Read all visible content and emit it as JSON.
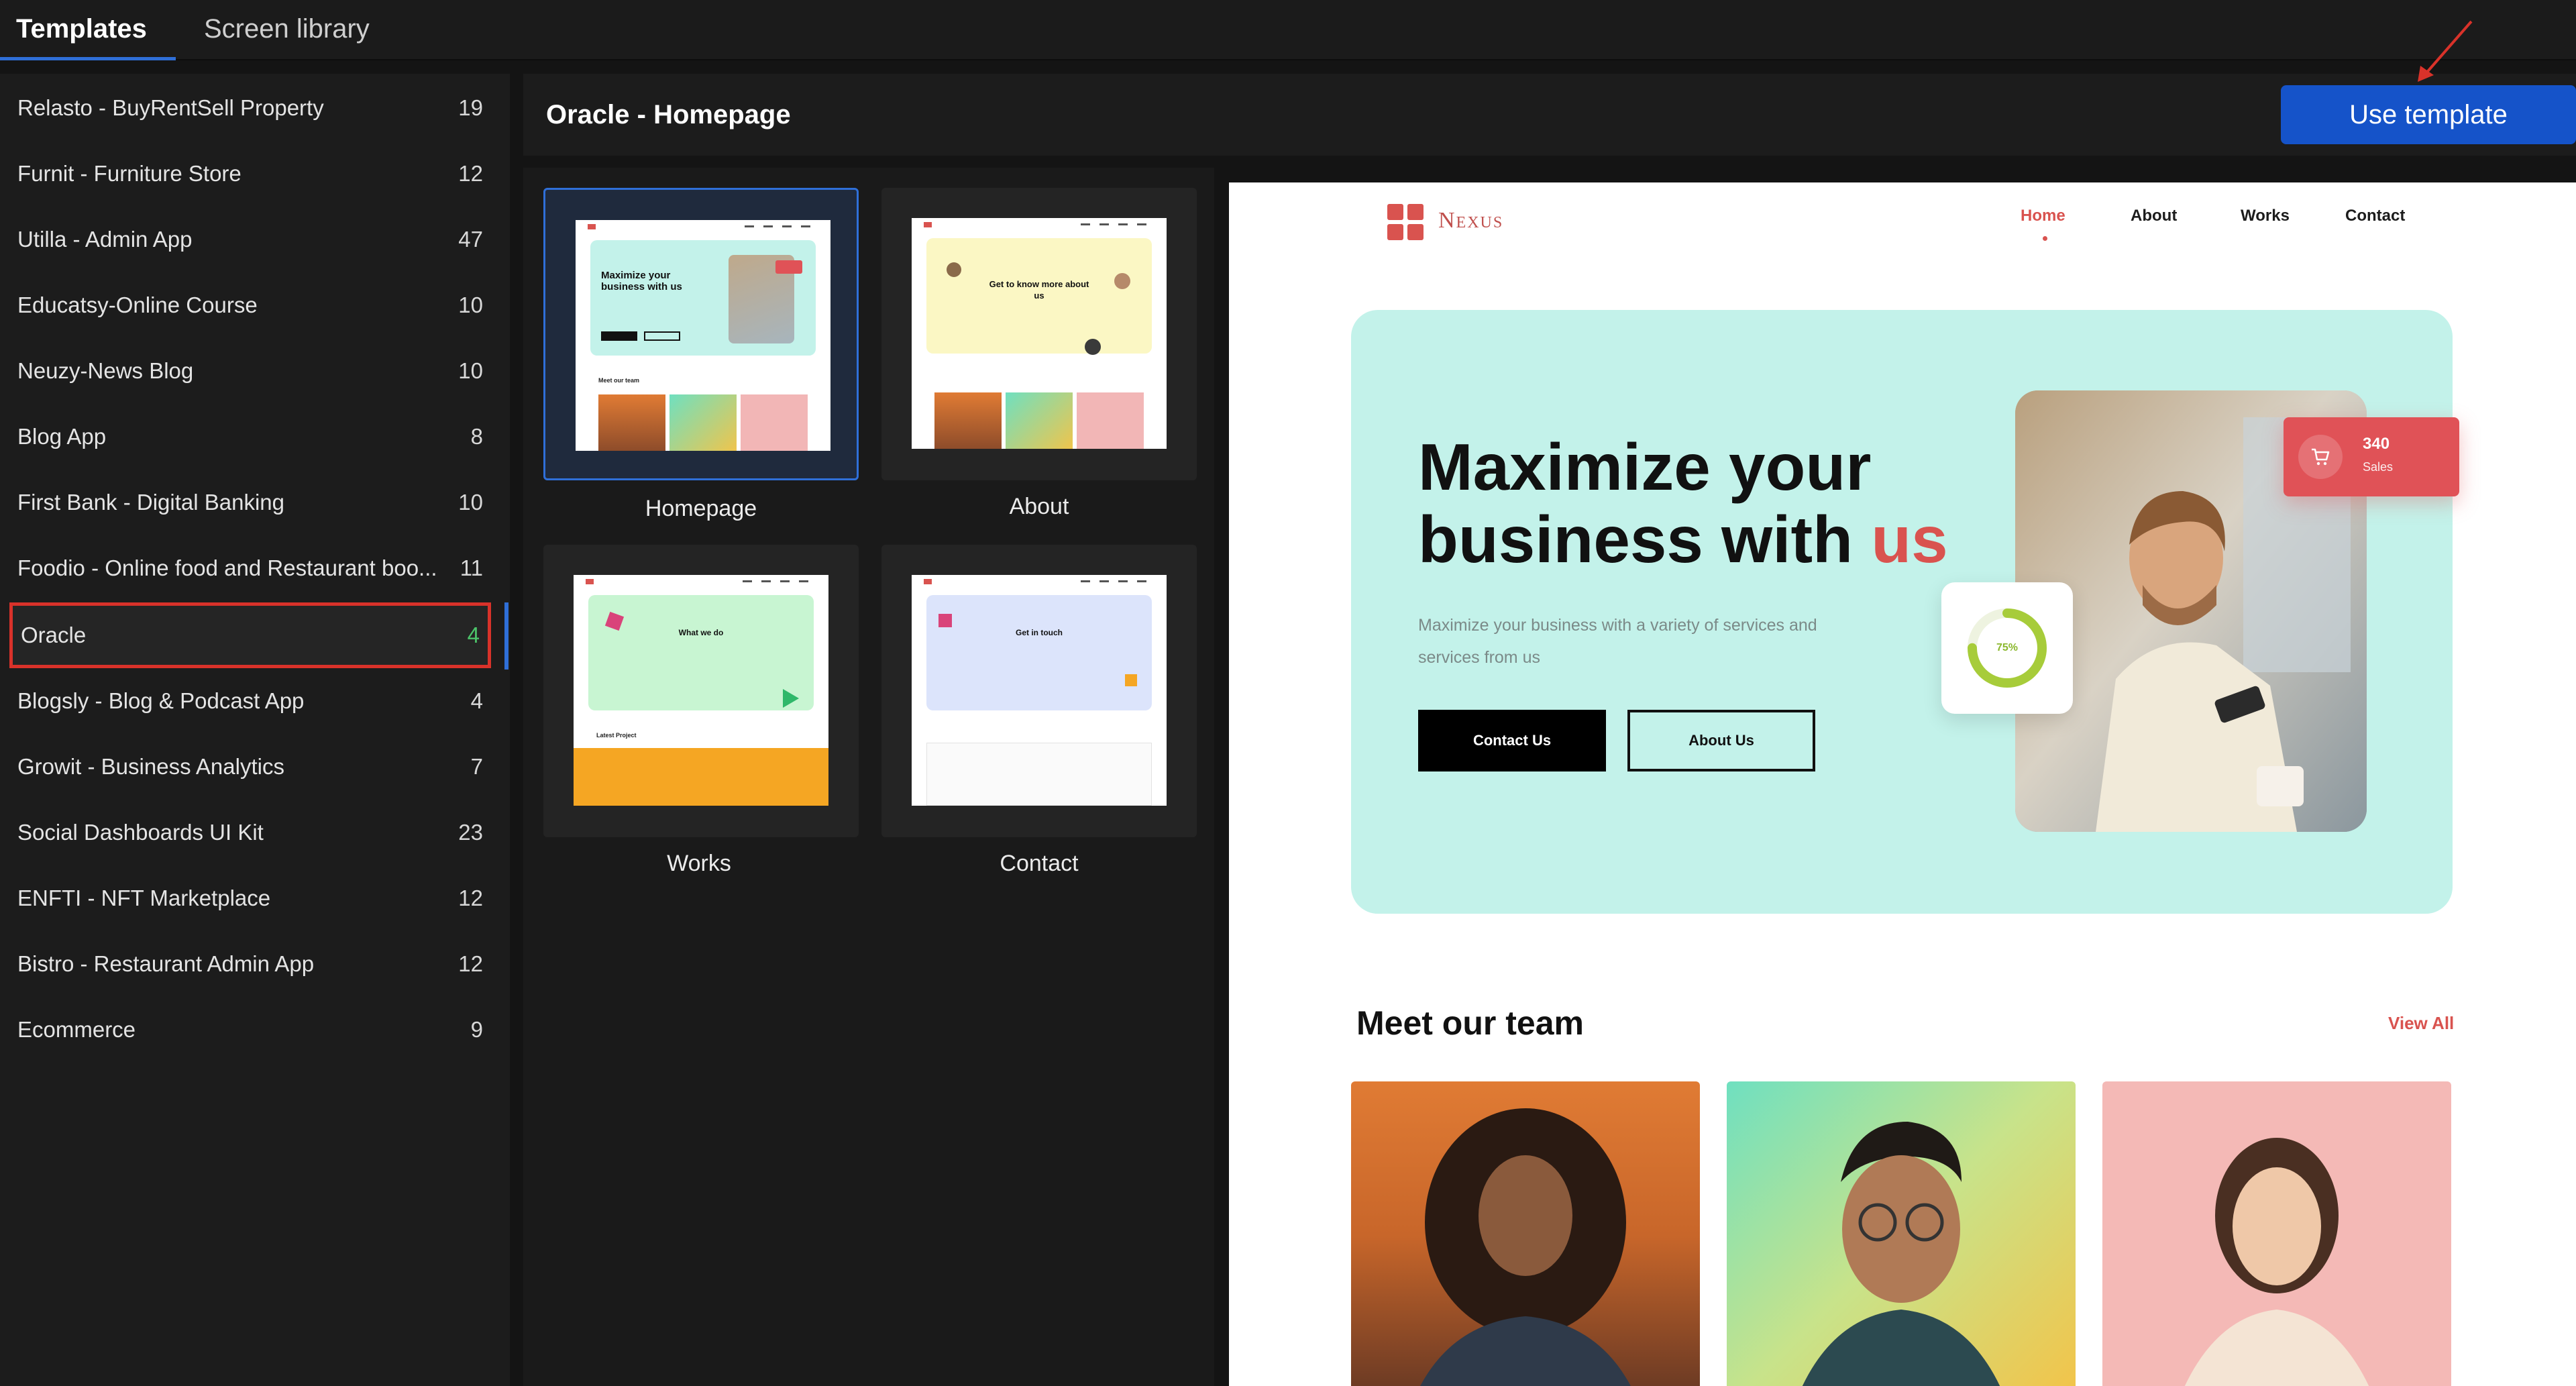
{
  "tabs": [
    {
      "label": "Templates",
      "active": true
    },
    {
      "label": "Screen library",
      "active": false
    }
  ],
  "sidebar": {
    "items": [
      {
        "label": "Relasto - BuyRentSell Property",
        "count": "19"
      },
      {
        "label": "Furnit - Furniture Store",
        "count": "12"
      },
      {
        "label": "Utilla - Admin App",
        "count": "47"
      },
      {
        "label": "Educatsy-Online Course",
        "count": "10"
      },
      {
        "label": "Neuzy-News Blog",
        "count": "10"
      },
      {
        "label": "Blog App",
        "count": "8"
      },
      {
        "label": "First Bank - Digital Banking",
        "count": "10"
      },
      {
        "label": "Foodio - Online food and Restaurant boo...",
        "count": "11"
      },
      {
        "label": "Oracle",
        "count": "4",
        "selected": true
      },
      {
        "label": "Blogsly - Blog & Podcast App",
        "count": "4"
      },
      {
        "label": "Growit - Business Analytics",
        "count": "7"
      },
      {
        "label": "Social Dashboards UI Kit",
        "count": "23"
      },
      {
        "label": "ENFTI - NFT Marketplace",
        "count": "12"
      },
      {
        "label": "Bistro - Restaurant Admin App",
        "count": "12"
      },
      {
        "label": "Ecommerce",
        "count": "9"
      }
    ]
  },
  "header": {
    "title": "Oracle - Homepage",
    "use_template_label": "Use template"
  },
  "thumbnails": [
    {
      "label": "Homepage",
      "selected": true
    },
    {
      "label": "About",
      "selected": false
    },
    {
      "label": "Works",
      "selected": false
    },
    {
      "label": "Contact",
      "selected": false
    }
  ],
  "thumb_text": {
    "home_hero": "Maximize your business with us",
    "home_team": "Meet our team",
    "about_hero": "Get to know more about us",
    "works_hero": "What we do",
    "works_project": "Latest Project",
    "contact_hero": "Get in touch"
  },
  "preview": {
    "brand": "Nexus",
    "nav": [
      "Home",
      "About",
      "Works",
      "Contact"
    ],
    "active_nav": "Home",
    "hero_title_line1": "Maximize your",
    "hero_title_line2": "business with",
    "hero_title_accent": "us",
    "hero_sub": "Maximize your business with a variety of services and services from us",
    "contact_btn": "Contact Us",
    "about_btn": "About Us",
    "progress_label": "75%",
    "progress_value": 0.75,
    "sales_count": "340",
    "sales_label": "Sales",
    "team_title": "Meet our team",
    "view_all": "View All"
  },
  "colors": {
    "accent_blue": "#1553c9",
    "selection_red": "#d9322a",
    "brand_red": "#d9534f",
    "hero_mint": "#c3f2ea",
    "count_green": "#4cc46a"
  }
}
